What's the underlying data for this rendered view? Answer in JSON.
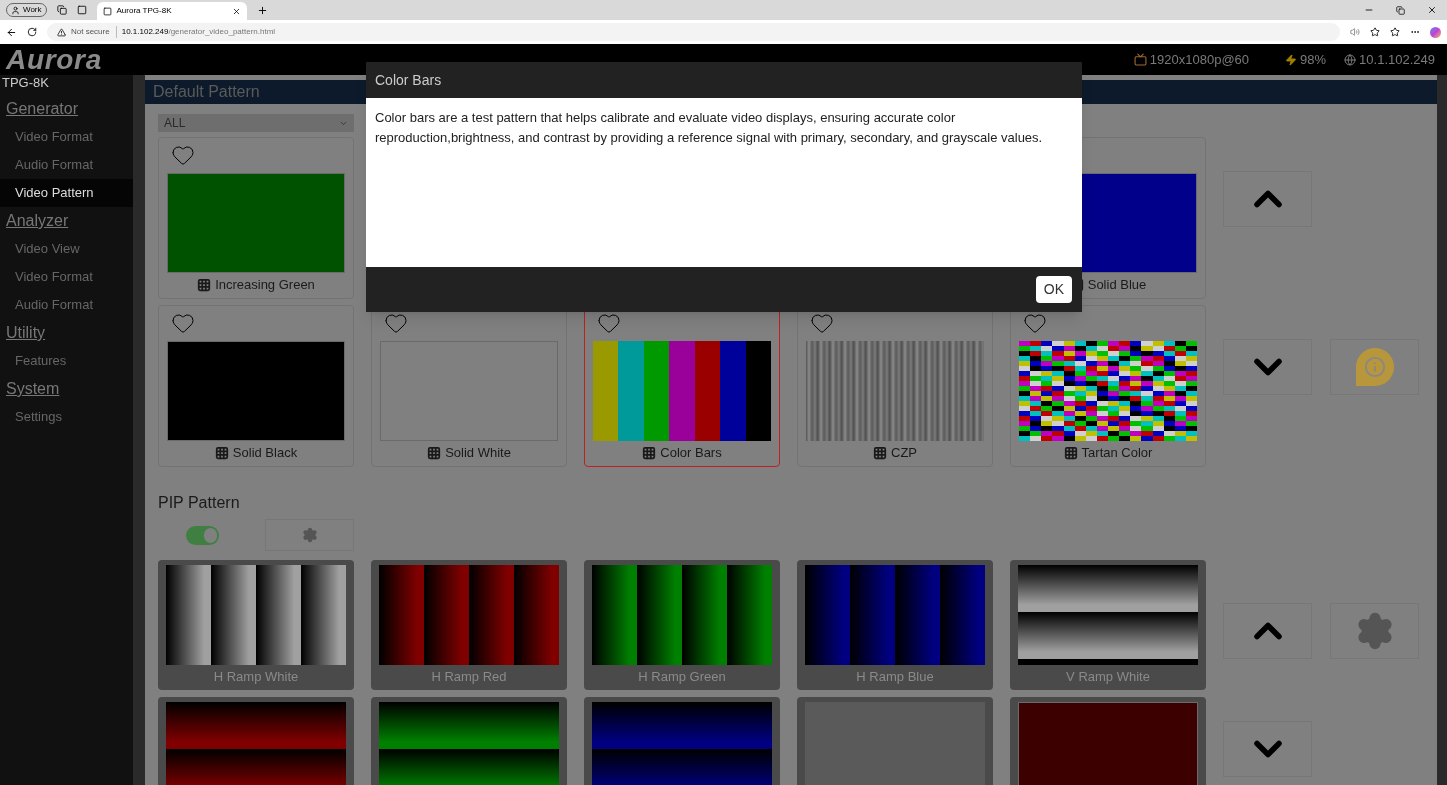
{
  "browser": {
    "profile": "Work",
    "tab_title": "Aurora TPG-8K",
    "security": "Not secure",
    "url_host": "10.1.102.249",
    "url_path": "/generator_video_pattern.html"
  },
  "header": {
    "logo": "Aurora",
    "resolution": "1920x1080p@60",
    "power": "98%",
    "ip": "10.1.102.249"
  },
  "sidebar": {
    "device": "TPG-8K",
    "sections": [
      {
        "title": "Generator",
        "items": [
          {
            "label": "Video Format",
            "selected": false
          },
          {
            "label": "Audio Format",
            "selected": false
          },
          {
            "label": "Video Pattern",
            "selected": true
          }
        ]
      },
      {
        "title": "Analyzer",
        "items": [
          {
            "label": "Video View",
            "selected": false
          },
          {
            "label": "Video Format",
            "selected": false
          },
          {
            "label": "Audio Format",
            "selected": false
          }
        ]
      },
      {
        "title": "Utility",
        "items": [
          {
            "label": "Features",
            "selected": false
          }
        ]
      },
      {
        "title": "System",
        "items": [
          {
            "label": "Settings",
            "selected": false
          }
        ]
      }
    ]
  },
  "default_pattern": {
    "title": "Default Pattern",
    "filter": "ALL",
    "row_1": [
      {
        "label": "Increasing Green",
        "kind": "solid",
        "color": "#005200",
        "selected": false,
        "favorite": false
      },
      {
        "label": "Solid Blue",
        "kind": "solid",
        "color": "#00008a",
        "selected": false
      }
    ],
    "row_2": [
      {
        "label": "Solid Black",
        "kind": "solid",
        "color": "#000000",
        "selected": false,
        "favorite": false
      },
      {
        "label": "Solid White",
        "kind": "solid",
        "color": "#808080",
        "selected": false,
        "favorite": false
      },
      {
        "label": "Color Bars",
        "kind": "bars",
        "selected": true,
        "favorite": false
      },
      {
        "label": "CZP",
        "kind": "czp",
        "selected": false,
        "favorite": false
      },
      {
        "label": "Tartan Color",
        "kind": "tartan",
        "selected": false,
        "favorite": false
      }
    ]
  },
  "pip_pattern": {
    "title": "PIP Pattern",
    "enabled": true,
    "row_1": [
      {
        "label": "H Ramp White",
        "kind": "h_ramp",
        "color": "#a0a0a0"
      },
      {
        "label": "H Ramp Red",
        "kind": "h_ramp",
        "color": "#800000"
      },
      {
        "label": "H Ramp Green",
        "kind": "h_ramp",
        "color": "#008000"
      },
      {
        "label": "H Ramp Blue",
        "kind": "h_ramp",
        "color": "#000080"
      },
      {
        "label": "V Ramp White",
        "kind": "v_ramp",
        "color": "#a0a0a0"
      }
    ],
    "row_2": [
      {
        "kind": "v_ramp",
        "color": "#800000"
      },
      {
        "kind": "v_ramp",
        "color": "#008000"
      },
      {
        "kind": "v_ramp",
        "color": "#000080"
      },
      {
        "kind": "blank"
      },
      {
        "kind": "solid",
        "color": "#3c0000"
      }
    ]
  },
  "dialog": {
    "title": "Color Bars",
    "message": "Color bars are a test pattern that helps calibrate and evaluate video displays, ensuring accurate color reproduction,brightness, and contrast by providing a reference signal with primary, secondary, and grayscale values.",
    "button": "OK"
  }
}
